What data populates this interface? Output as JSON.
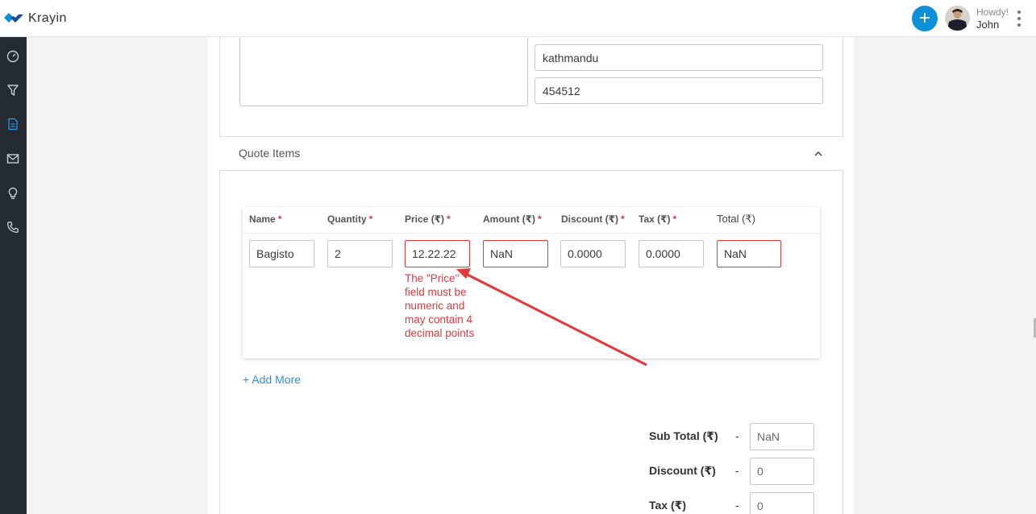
{
  "app": {
    "name": "Krayin"
  },
  "header": {
    "greeting": "Howdy!",
    "user_name": "John",
    "add_icon": "plus-icon",
    "menu_icon": "kebab-icon"
  },
  "sidebar": {
    "items": [
      {
        "icon": "dashboard-icon"
      },
      {
        "icon": "filter-icon"
      },
      {
        "icon": "quote-document-icon",
        "active": true
      },
      {
        "icon": "mail-icon"
      },
      {
        "icon": "lightbulb-icon"
      },
      {
        "icon": "phone-icon"
      }
    ]
  },
  "address": {
    "city": "kathmandu",
    "postcode": "454512"
  },
  "quote_items": {
    "title": "Quote Items",
    "columns": [
      {
        "label": "Name",
        "required": true
      },
      {
        "label": "Quantity",
        "required": true
      },
      {
        "label": "Price (₹)",
        "required": true
      },
      {
        "label": "Amount (₹)",
        "required": true
      },
      {
        "label": "Discount (₹)",
        "required": true
      },
      {
        "label": "Tax (₹)",
        "required": true
      },
      {
        "label": "Total (₹)",
        "required": false
      }
    ],
    "rows": [
      {
        "name": "Bagisto",
        "quantity": "2",
        "price": "12.22.22",
        "amount": "NaN",
        "discount": "0.0000",
        "tax": "0.0000",
        "total": "NaN"
      }
    ],
    "price_error": "The \"Price\" field must be numeric and may contain 4 decimal points",
    "add_more": "+ Add More"
  },
  "summary": [
    {
      "label": "Sub Total (₹)",
      "dash": "-",
      "value": "NaN"
    },
    {
      "label": "Discount (₹)",
      "dash": "-",
      "value": "0"
    },
    {
      "label": "Tax (₹)",
      "dash": "-",
      "value": "0"
    }
  ],
  "colors": {
    "accent": "#0e90d9",
    "error": "#e3383b",
    "sidebar": "#242b33",
    "link": "#2d8ed6"
  }
}
